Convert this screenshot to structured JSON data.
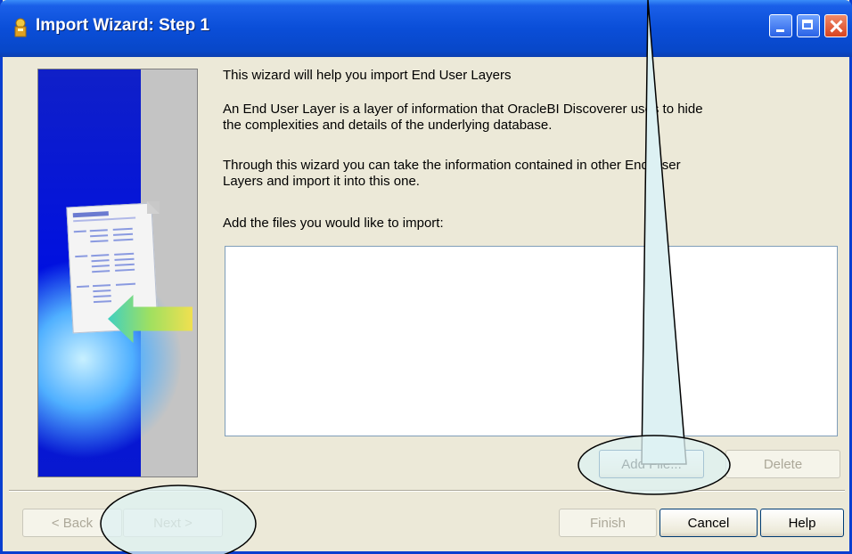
{
  "window": {
    "title": "Import Wizard: Step 1"
  },
  "content": {
    "intro": "This wizard will help you import End User Layers",
    "description": "An End User Layer is a layer of information that OracleBI Discoverer uses to hide the complexities and details of the underlying database.",
    "instructions": "Through this wizard you can take the information contained in other End User Layers and import it into this one.",
    "files_label": "Add the files you would like to import:"
  },
  "file_list": {
    "items": []
  },
  "buttons": {
    "add_file": "Add File...",
    "delete": "Delete",
    "back": "< Back",
    "next": "Next >",
    "finish": "Finish",
    "cancel": "Cancel",
    "help": "Help"
  },
  "icons": [
    "wizard-icon",
    "minimize-icon",
    "maximize-icon",
    "close-icon",
    "import-document-icon",
    "import-arrow-icon"
  ],
  "colors": {
    "titlebar": "#0A4ED8",
    "dialog_bg": "#ECE9D8",
    "callout_fill": "#DDF1F3",
    "disabled_text": "#ACA899"
  }
}
